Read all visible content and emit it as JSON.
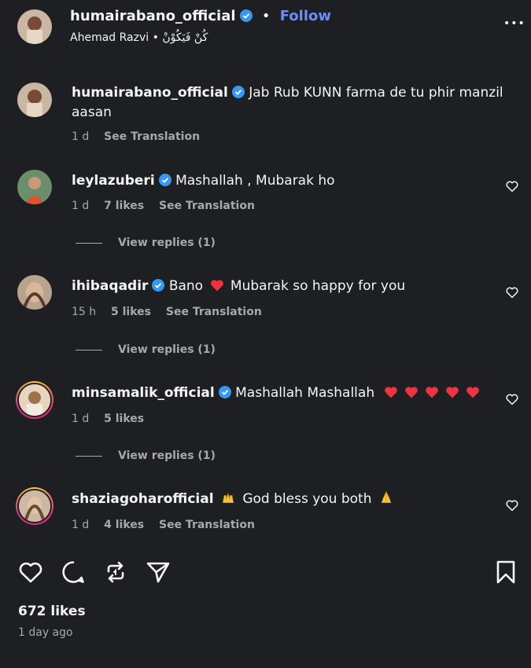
{
  "header": {
    "username": "humairabano_official",
    "follow_label": "Follow",
    "subtitle": "Ahemad Razvi • كُنْ فَيَكُوْنْ",
    "more_label": "•••"
  },
  "comments": [
    {
      "username": "humairabano_official",
      "text_line1": "Jab Rub KUNN farma de tu phir manzil",
      "text_line2": "aasan",
      "time": "1 d",
      "translation": "See Translation"
    },
    {
      "username": "leylazuberi",
      "text": "Mashallah , Mubarak ho",
      "time": "1 d",
      "likes": "7 likes",
      "translation": "See Translation",
      "replies": "View replies (1)"
    },
    {
      "username": "ihibaqadir",
      "text_before": "Bano",
      "text_after": "Mubarak so happy for you",
      "time": "15 h",
      "likes": "5 likes",
      "translation": "See Translation",
      "replies": "View replies (1)"
    },
    {
      "username": "minsamalik_official",
      "text": "Mashallah Mashallah",
      "time": "1 d",
      "likes": "5 likes",
      "replies": "View replies (1)"
    },
    {
      "username": "shaziagoharofficial",
      "text": "God bless you both",
      "time": "1 d",
      "likes": "4 likes",
      "translation": "See Translation"
    }
  ],
  "footer": {
    "likes": "672 likes",
    "posted": "1 day ago"
  },
  "colors": {
    "background": "#1e1f22",
    "verified": "#3897f0",
    "follow": "#6b8cff",
    "heart_emoji": "#ef3340"
  }
}
